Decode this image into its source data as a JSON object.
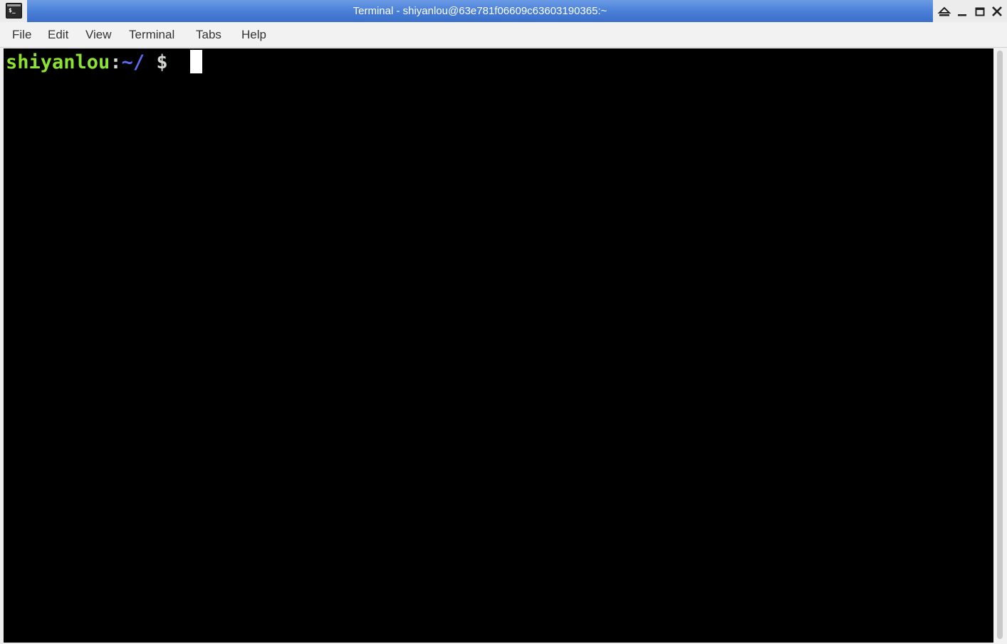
{
  "window": {
    "title": "Terminal - shiyanlou@63e781f06609c63603190365:~",
    "controls": {
      "shade": "shade-icon",
      "minimize": "minimize-icon",
      "maximize": "maximize-icon",
      "close": "close-icon"
    },
    "titlebar_color": "#4a80d8",
    "app_icon": "terminal-icon",
    "app_icon_text": "$_"
  },
  "menubar": {
    "items": [
      {
        "label": "File"
      },
      {
        "label": "Edit"
      },
      {
        "label": "View"
      },
      {
        "label": "Terminal"
      },
      {
        "label": "Tabs"
      },
      {
        "label": "Help"
      }
    ]
  },
  "terminal": {
    "background": "#000000",
    "prompt": {
      "user": "shiyanlou",
      "separator": ":",
      "path": "~/",
      "symbol": " $ ",
      "user_color": "#8ae234",
      "path_color": "#5c6cf0"
    }
  }
}
